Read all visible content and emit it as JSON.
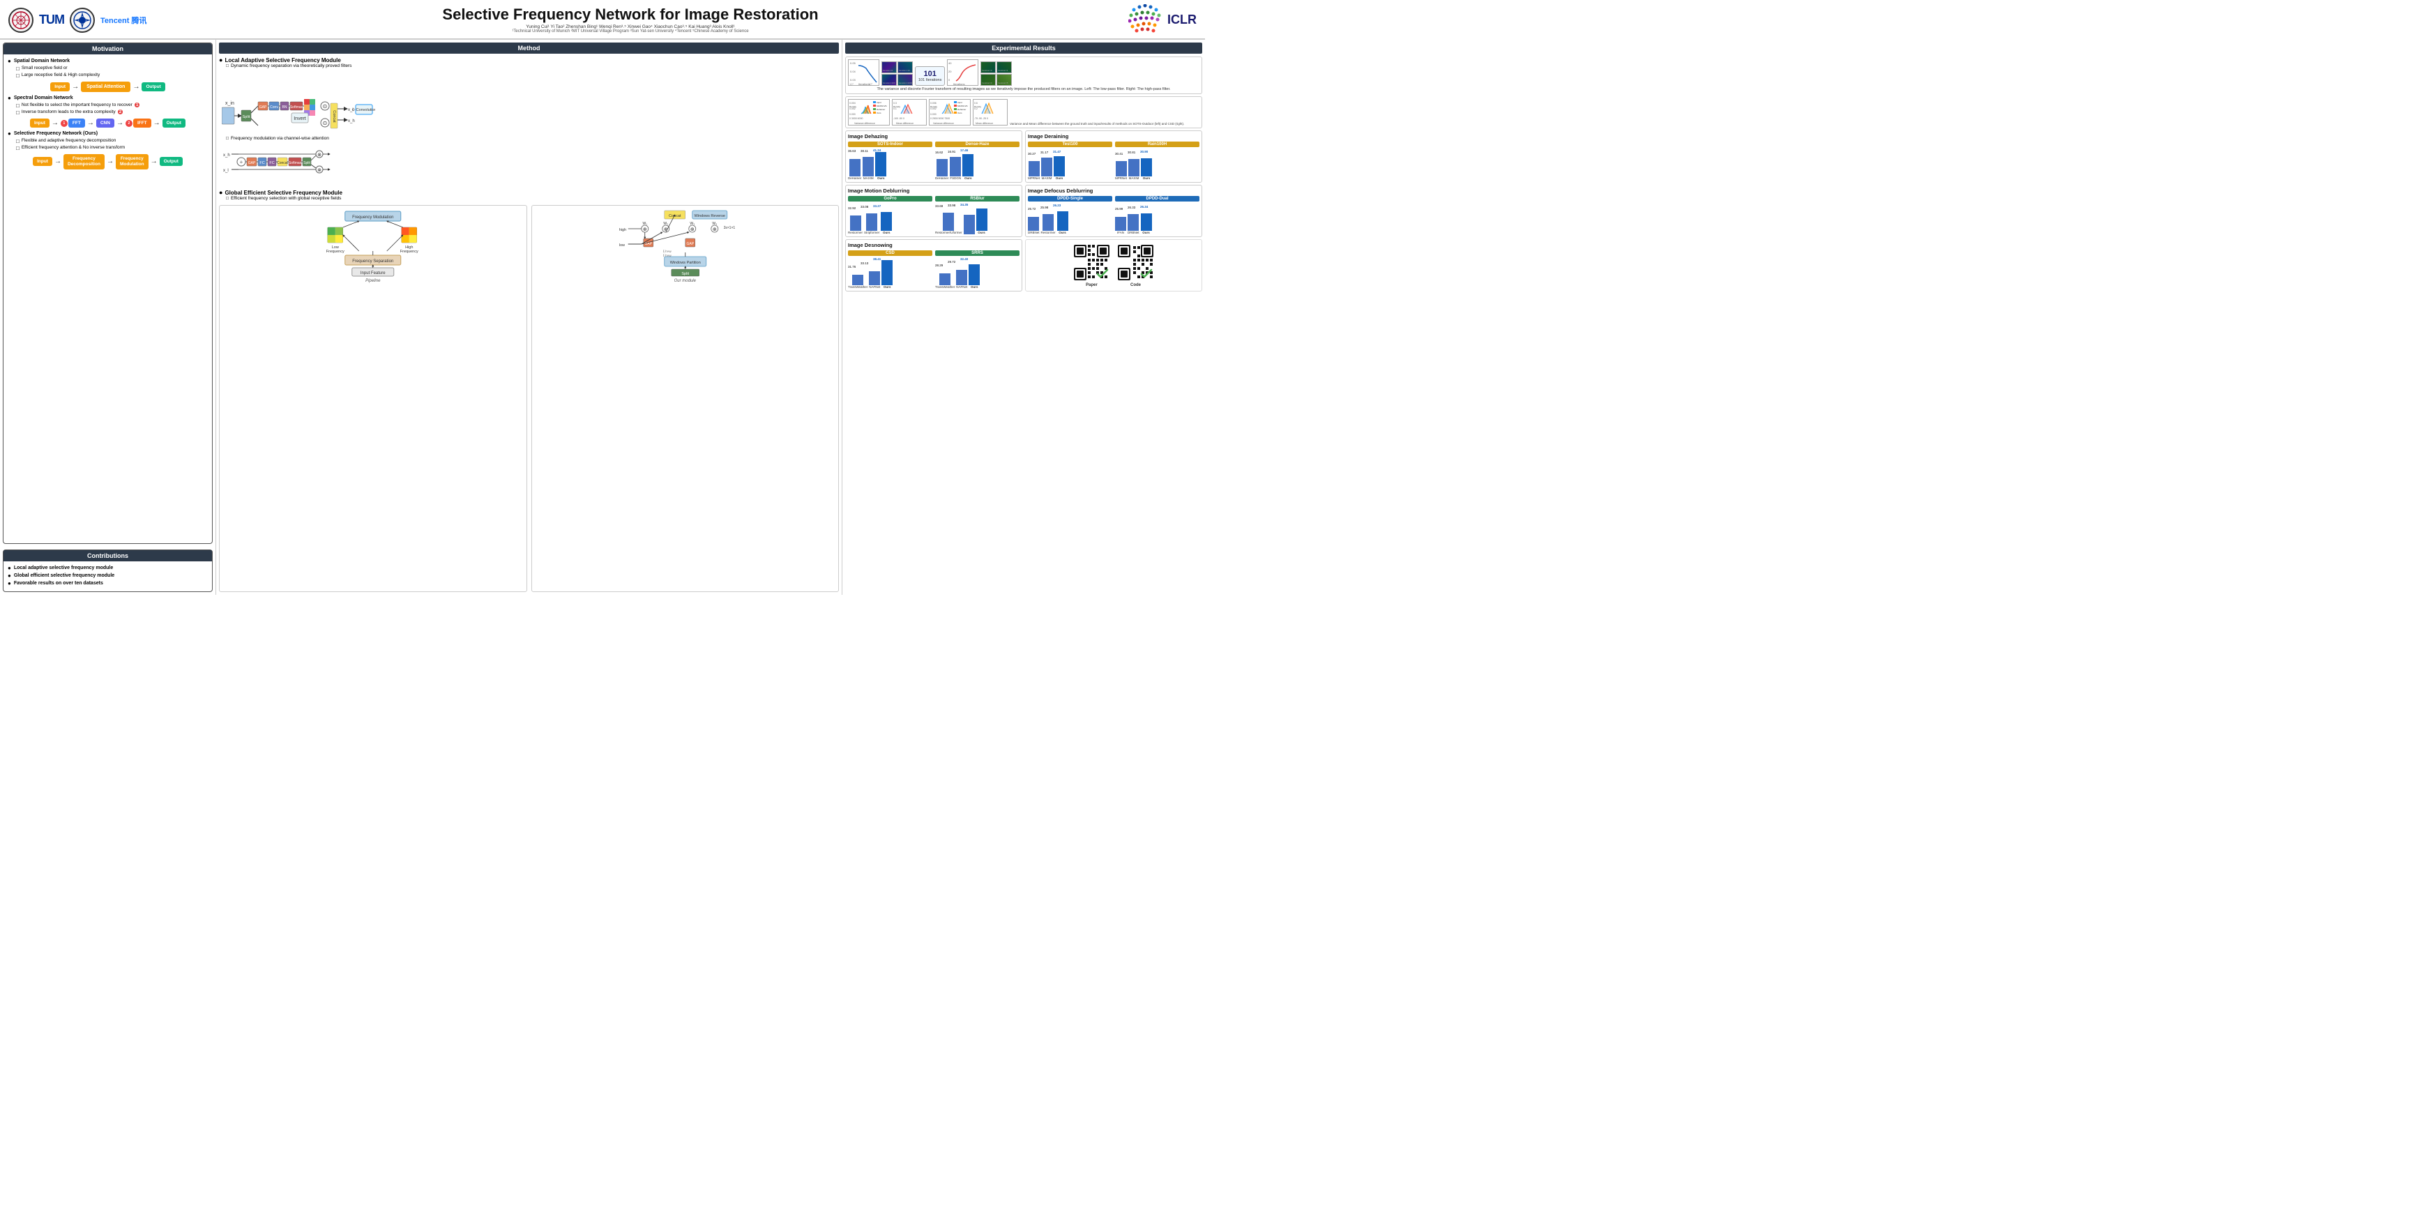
{
  "header": {
    "title": "Selective Frequency Network for Image Restoration",
    "authors": "Yuning Cui¹  Yi Tao²  Zhenshan Bing¹  Wenqi Ren³˒⁵  Xinwei Gao⁴  Xiaochun Cao³˒⁵  Kai Huang³  Alois Knoll¹",
    "affiliations": "¹Technical University of Munich  ²MIT Universal Village Program  ³Sun Yat-sen University  ⁴Tencent  ⁵Chinese Academy of Science",
    "conference": "ICLR"
  },
  "motivation": {
    "title": "Motivation",
    "spatial_domain": {
      "label": "Spatial Domain Network",
      "items": [
        "Small receptive field or",
        "Large receptive field & High complexity"
      ]
    },
    "spectral_domain": {
      "label": "Spectral Domain Network",
      "items": [
        "Not flexible to select the important frequency to recover",
        "Inverse transform leads to the extra complexity"
      ]
    },
    "selective_freq": {
      "label": "Selective Frequency Network (Ours)",
      "items": [
        "Flexible and adaptive frequency decomposition",
        "Efficient frequency attention & No inverse transform"
      ]
    },
    "flow_labels": {
      "input": "Input",
      "output": "Output",
      "spatial_attention": "Spatial Attention",
      "fft": "FFT",
      "cnn": "CNN",
      "ifft": "IFFT",
      "freq_decomp": "Frequency\nDecomposition",
      "freq_mod": "Frequency\nModulation"
    }
  },
  "contributions": {
    "title": "Contributions",
    "items": [
      "Local adaptive selective frequency module",
      "Global efficient selective frequency module",
      "Favorable results on over ten datasets"
    ]
  },
  "method": {
    "title": "Method",
    "lasf": {
      "title": "Local Adaptive Selective Frequency Module",
      "desc": "Dynamic frequency separation via theoretically proved filters"
    },
    "freq_mod": {
      "desc": "Frequency modulation via channel-wise attention"
    },
    "gesf": {
      "title": "Global Efficient Selective Frequency Module",
      "desc": "Efficient frequency selection with global receptive fields"
    },
    "pipeline_label": "Pipeline",
    "module_label": "Our module",
    "iterations_label": "101 Iterations"
  },
  "results": {
    "title": "Experimental Results",
    "variance_caption": "The variance and discrete Fourier transform of resulting images as we iteratively impose the produced filters on an image. Left: The low-pass filter. Right: The high-pass filter.",
    "density_caption": "Variance and Mean difference between the ground truth and input/results of methods on SOTS-Outdoor (left) and CSD (right).",
    "dehazing": {
      "title": "Image Dehazing",
      "sots_indoor": {
        "label": "SOTS-Indoor",
        "bars": [
          {
            "name": "DeHamer",
            "val": 36.63
          },
          {
            "name": "MAXIM",
            "val": 38.11
          },
          {
            "name": "Ours",
            "val": 41.24
          }
        ]
      },
      "dense_haze": {
        "label": "Dense-Haze",
        "bars": [
          {
            "name": "DeHamer",
            "val": 16.62
          },
          {
            "name": "FSDGN",
            "val": 16.91
          },
          {
            "name": "Ours",
            "val": 17.46
          }
        ]
      }
    },
    "deraining": {
      "title": "Image Deraining",
      "test100": {
        "label": "Test100",
        "bars": [
          {
            "name": "MPRNet",
            "val": 30.27
          },
          {
            "name": "MAXIM",
            "val": 31.17
          },
          {
            "name": "Ours",
            "val": 31.47
          }
        ]
      },
      "rain100h": {
        "label": "Rain100H",
        "bars": [
          {
            "name": "MPRNet",
            "val": 30.41
          },
          {
            "name": "MAXIM",
            "val": 30.81
          },
          {
            "name": "Ours",
            "val": 30.9
          }
        ]
      }
    },
    "motion_deblurring": {
      "title": "Image Motion Deblurring",
      "gopro": {
        "label": "GoPro",
        "bars": [
          {
            "name": "Restormer",
            "val": 32.92
          },
          {
            "name": "Stripformer",
            "val": 33.08
          },
          {
            "name": "Ours",
            "val": 33.27
          }
        ]
      },
      "rsblur": {
        "label": "RSBlur",
        "bars": [
          {
            "name": "Restormer/Uformer",
            "val": 33.69
          },
          {
            "name": "",
            "val": 33.98
          },
          {
            "name": "Ours",
            "val": 34.35
          }
        ]
      }
    },
    "defocus_deblurring": {
      "title": "Image Defocus Deblurring",
      "dpdd_single": {
        "label": "DPDD-Single",
        "bars": [
          {
            "name": "DRBNet",
            "val": 25.72
          },
          {
            "name": "Restormer",
            "val": 25.98
          },
          {
            "name": "Ours",
            "val": 26.23
          }
        ]
      },
      "dpdd_dual": {
        "label": "DPDD-Dual",
        "bars": [
          {
            "name": "IFAN",
            "val": 25.99
          },
          {
            "name": "DRBNet",
            "val": 26.33
          },
          {
            "name": "Ours",
            "val": 26.34
          }
        ]
      }
    },
    "desnowing": {
      "title": "Image Desnowing",
      "csd": {
        "label": "CSD",
        "bars": [
          {
            "name": "TransWeather",
            "val": 31.76
          },
          {
            "name": "NAFNet",
            "val": 33.13
          },
          {
            "name": "Ours",
            "val": 38.41
          }
        ]
      },
      "srrs": {
        "label": "SRRS",
        "bars": [
          {
            "name": "TransWeather",
            "val": 28.29
          },
          {
            "name": "NAFNet",
            "val": 29.72
          },
          {
            "name": "Ours",
            "val": 32.4
          }
        ]
      }
    },
    "qr_paper_label": "Paper",
    "qr_code_label": "Code"
  }
}
